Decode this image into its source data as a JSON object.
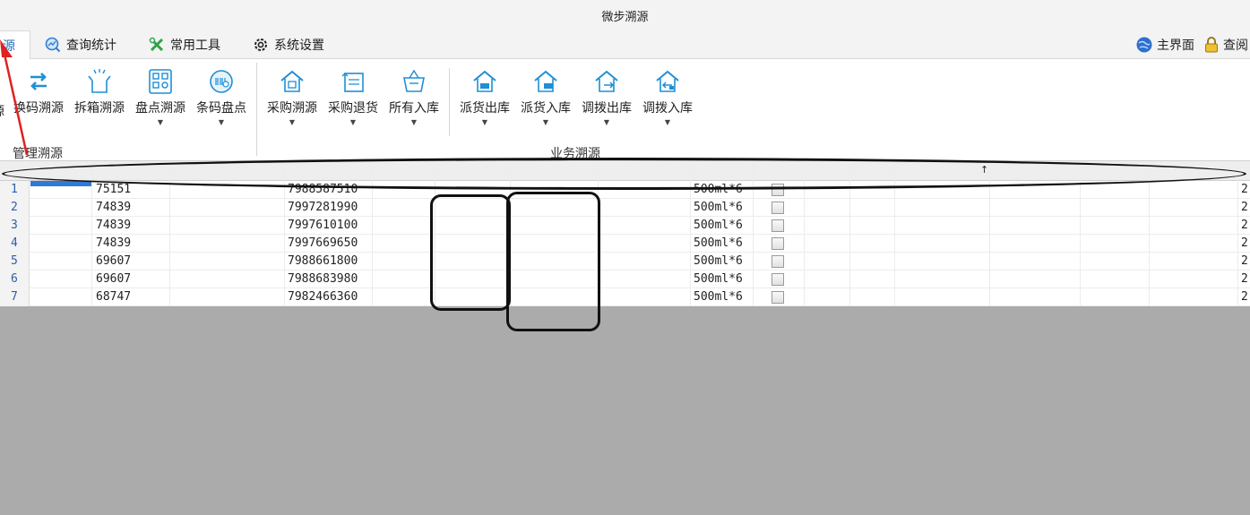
{
  "window": {
    "title": "微步溯源"
  },
  "tabs": [
    {
      "label": "源",
      "icon": "traceback-icon",
      "active": true
    },
    {
      "label": "查询统计",
      "icon": "query-stats-icon",
      "active": false
    },
    {
      "label": "常用工具",
      "icon": "tools-icon",
      "active": false
    },
    {
      "label": "系统设置",
      "icon": "gear-icon",
      "active": false
    }
  ],
  "header_links": [
    {
      "label": "主界面",
      "icon": "globe-icon"
    },
    {
      "label": "查阅",
      "icon": "lock-icon"
    }
  ],
  "ribbon": {
    "management": {
      "group_label": "管理溯源",
      "partial_label": "源",
      "buttons": [
        {
          "label": "换码溯源",
          "icon": "swap-arrows-icon",
          "has_dropdown": false
        },
        {
          "label": "拆箱溯源",
          "icon": "open-box-icon",
          "has_dropdown": false
        },
        {
          "label": "盘点溯源",
          "icon": "inventory-qr-icon",
          "has_dropdown": true
        },
        {
          "label": "条码盘点",
          "icon": "barcode-scan-icon",
          "has_dropdown": true
        }
      ]
    },
    "business": {
      "group_label": "业务溯源",
      "buttons": [
        {
          "label": "采购溯源",
          "icon": "purchase-house-icon",
          "has_dropdown": true
        },
        {
          "label": "采购退货",
          "icon": "purchase-return-icon",
          "has_dropdown": true
        },
        {
          "label": "所有入库",
          "icon": "basket-icon",
          "has_dropdown": true
        },
        {
          "label": "派货出库",
          "icon": "dispatch-out-icon",
          "has_dropdown": true
        },
        {
          "label": "派货入库",
          "icon": "dispatch-in-icon",
          "has_dropdown": true
        },
        {
          "label": "调拨出库",
          "icon": "transfer-out-icon",
          "has_dropdown": true
        },
        {
          "label": "调拨入库",
          "icon": "transfer-in-icon",
          "has_dropdown": true
        }
      ]
    }
  },
  "grid": {
    "sort_indicator": "↑",
    "rows": [
      {
        "num": "1",
        "code": "75151",
        "barcode": "7988587510",
        "spec": "500ml*6",
        "tail": "2"
      },
      {
        "num": "2",
        "code": "74839",
        "barcode": "7997281990",
        "spec": "500ml*6",
        "tail": "2"
      },
      {
        "num": "3",
        "code": "74839",
        "barcode": "7997610100",
        "spec": "500ml*6",
        "tail": "2"
      },
      {
        "num": "4",
        "code": "74839",
        "barcode": "7997669650",
        "spec": "500ml*6",
        "tail": "2"
      },
      {
        "num": "5",
        "code": "69607",
        "barcode": "7988661800",
        "spec": "500ml*6",
        "tail": "2"
      },
      {
        "num": "6",
        "code": "69607",
        "barcode": "7988683980",
        "spec": "500ml*6",
        "tail": "2"
      },
      {
        "num": "7",
        "code": "68747",
        "barcode": "7982466360",
        "spec": "500ml*6",
        "tail": "2"
      }
    ]
  },
  "colors": {
    "accent": "#1e8fd6",
    "selection": "#2e7ad6",
    "annotation": "#111111",
    "arrow": "#e02020"
  }
}
